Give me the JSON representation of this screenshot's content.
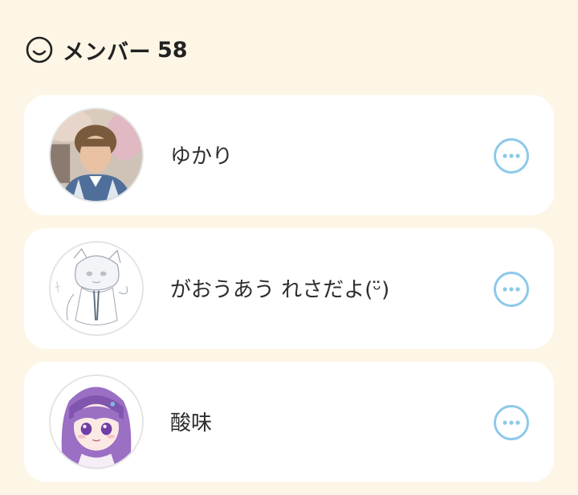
{
  "header": {
    "icon": "smiley-icon",
    "title": "メンバー",
    "count": "58"
  },
  "members": [
    {
      "name": "ゆかり",
      "avatar": "photo-avatar",
      "more_icon": "more-horizontal-icon"
    },
    {
      "name": "がおうあう れさだよ(ᵕ̈)",
      "avatar": "sketch-illustration-avatar",
      "more_icon": "more-horizontal-icon"
    },
    {
      "name": "酸味",
      "avatar": "purple-haired-girl-avatar",
      "more_icon": "more-horizontal-icon"
    }
  ],
  "colors": {
    "background": "#fdf6e6",
    "card": "#ffffff",
    "accent": "#8dc9ea"
  }
}
